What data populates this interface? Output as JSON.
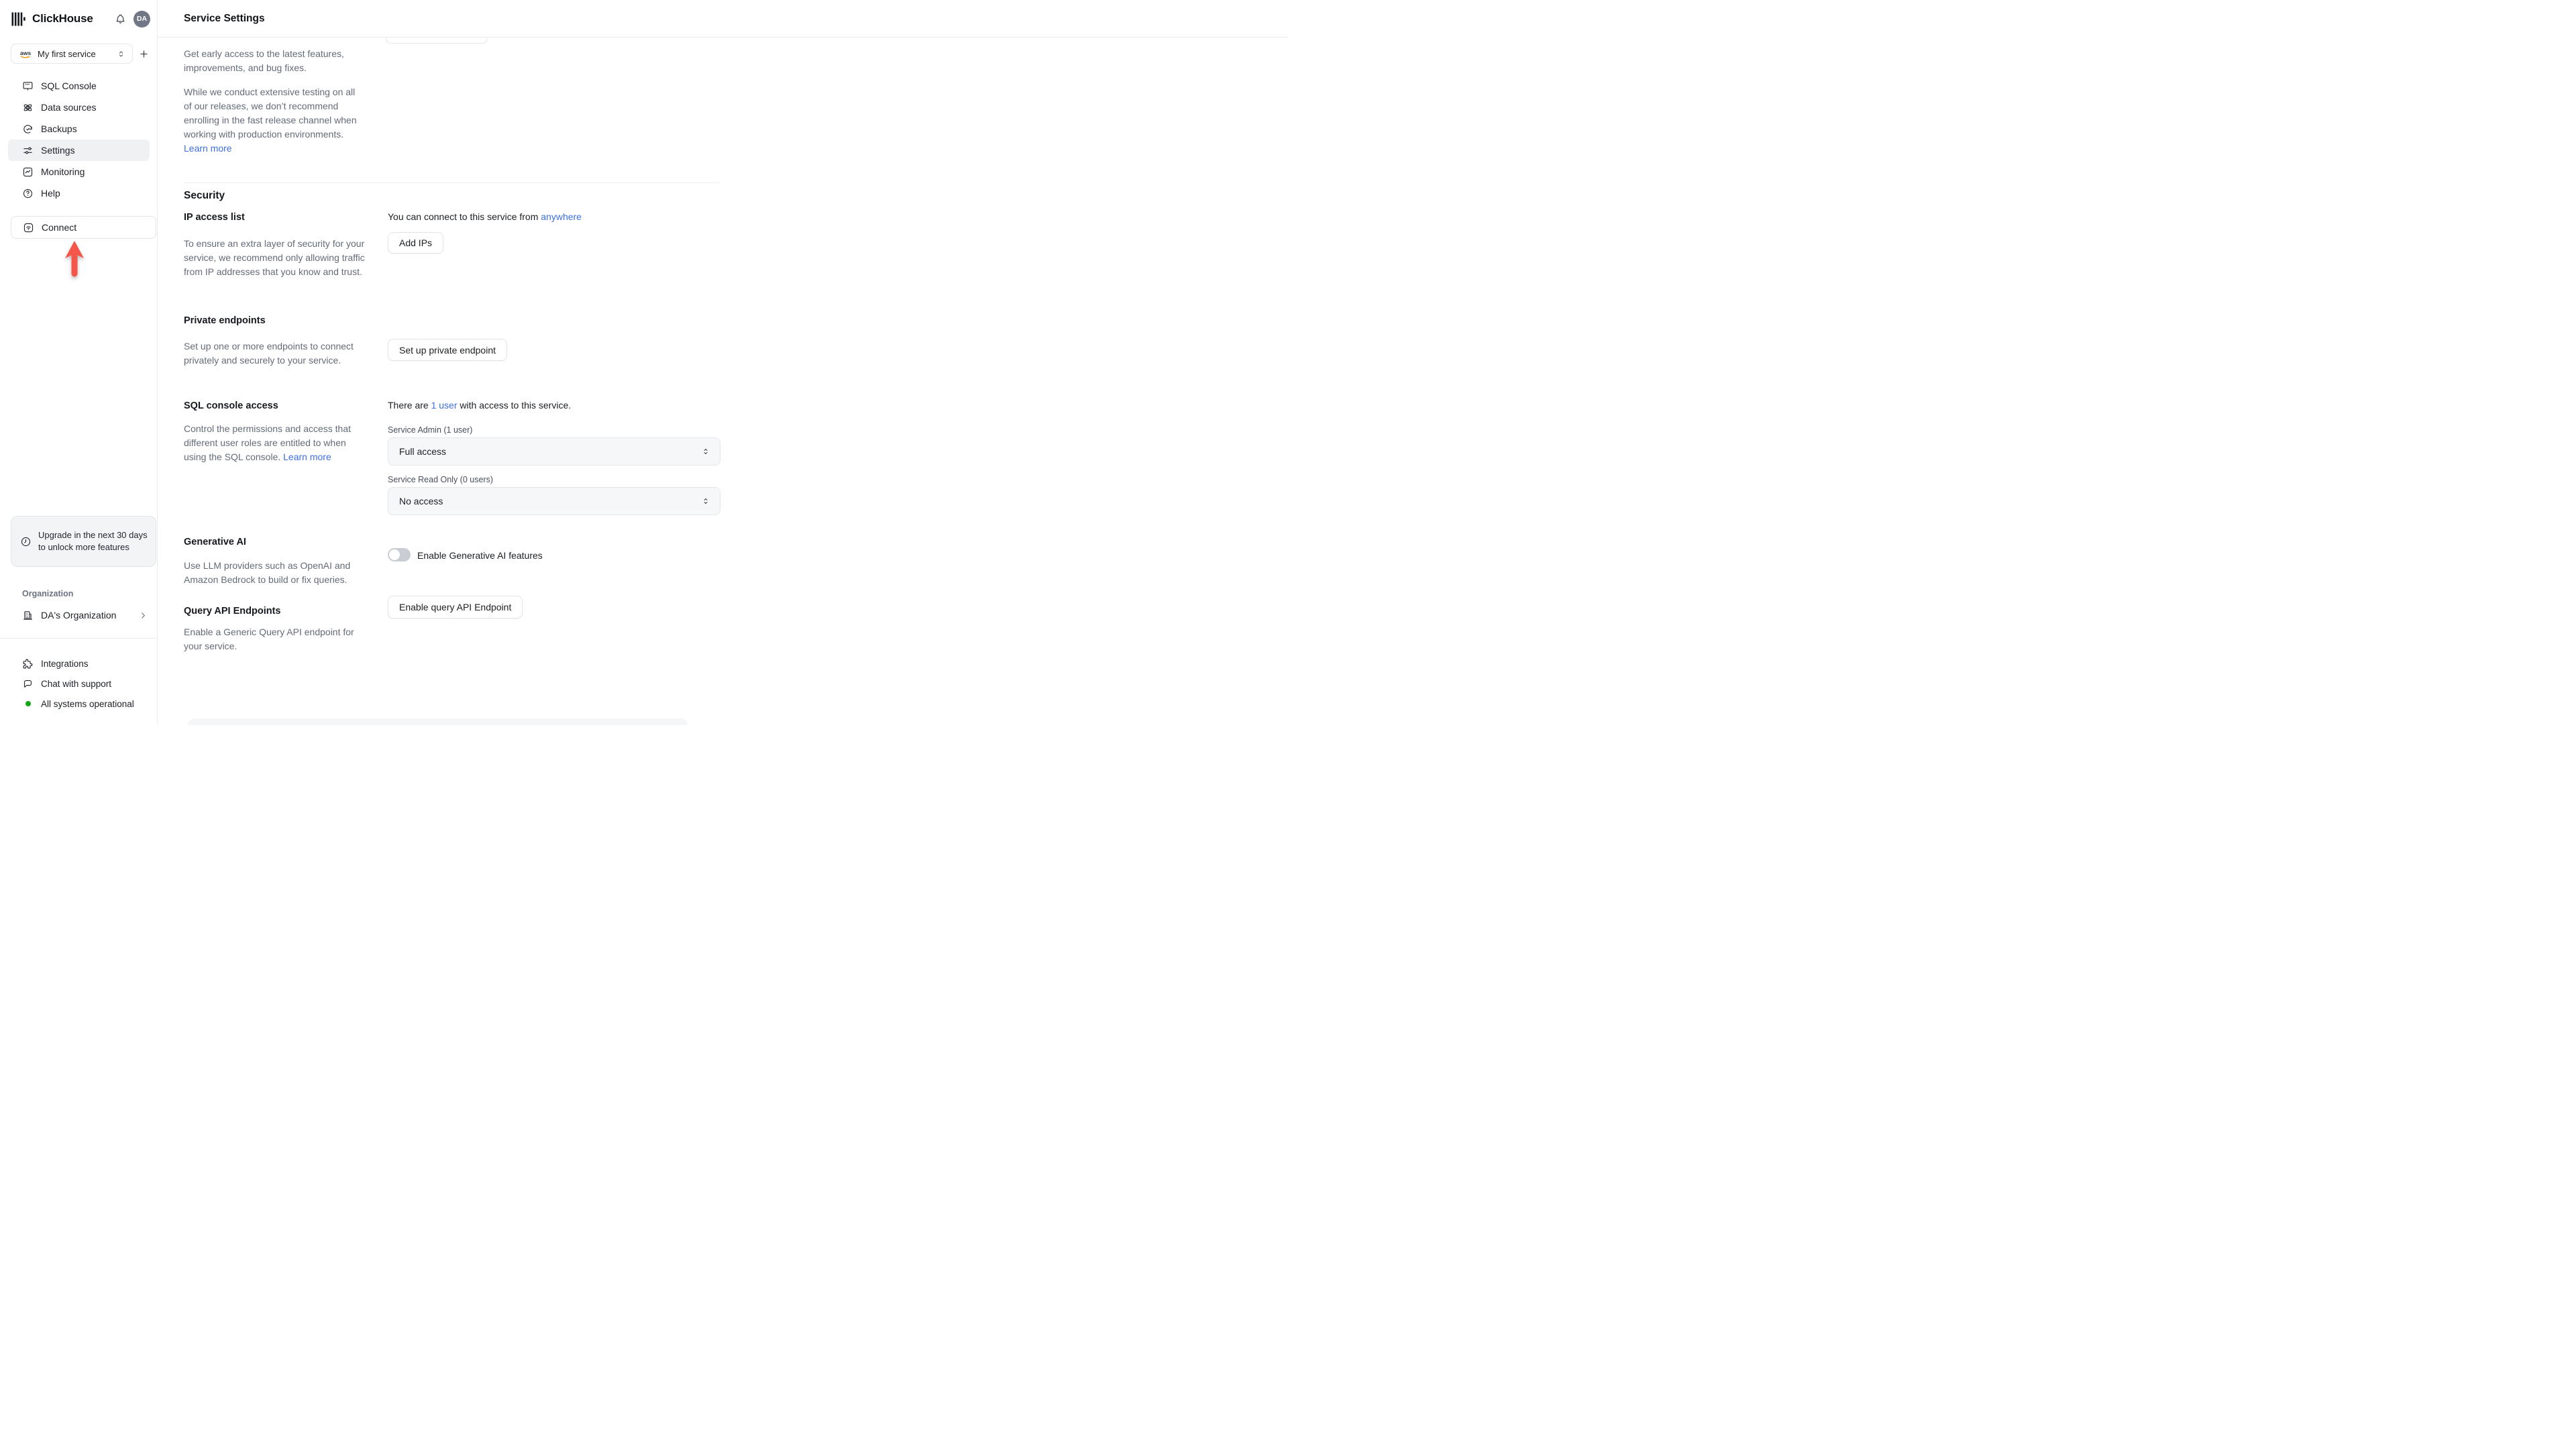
{
  "header": {
    "app_name": "ClickHouse",
    "avatar_initials": "DA"
  },
  "service_selector": {
    "name": "My first service",
    "provider": "aws"
  },
  "sidebar": {
    "nav": [
      {
        "label": "SQL Console"
      },
      {
        "label": "Data sources"
      },
      {
        "label": "Backups"
      },
      {
        "label": "Settings",
        "active": true
      },
      {
        "label": "Monitoring"
      },
      {
        "label": "Help"
      }
    ],
    "connect_label": "Connect",
    "upgrade_notice": "Upgrade in the next 30 days to unlock more features",
    "org_section_label": "Organization",
    "org_name": "DA's Organization",
    "footer": [
      {
        "label": "Integrations"
      },
      {
        "label": "Chat with support"
      },
      {
        "label": "All systems operational"
      }
    ]
  },
  "page": {
    "title": "Service Settings"
  },
  "release_channel": {
    "para1": "Get early access to the latest features, improvements, and bug fixes.",
    "para2": "While we conduct extensive testing on all of our releases, we don’t recommend enrolling in the fast release channel when working with production environments. ",
    "learn_more": "Learn more"
  },
  "security": {
    "heading": "Security",
    "ip_access": {
      "title": "IP access list",
      "description": "To ensure an extra layer of security for your service, we recommend only allowing traffic from IP addresses that you know and trust.",
      "status_prefix": "You can connect to this service from ",
      "status_link": "anywhere",
      "button": "Add IPs"
    },
    "private_endpoints": {
      "title": "Private endpoints",
      "description": "Set up one or more endpoints to connect privately and securely to your service.",
      "button": "Set up private endpoint"
    },
    "sql_console_access": {
      "title": "SQL console access",
      "description": "Control the permissions and access that different user roles are entitled to when using the SQL console. ",
      "learn_more": "Learn more",
      "summary_prefix": "There are ",
      "summary_link": "1 user",
      "summary_suffix": " with access to this service.",
      "admin_label": "Service Admin (1 user)",
      "admin_value": "Full access",
      "readonly_label": "Service Read Only (0 users)",
      "readonly_value": "No access"
    },
    "generative_ai": {
      "title": "Generative AI",
      "description": "Use LLM providers such as OpenAI and Amazon Bedrock to build or fix queries.",
      "toggle_label": "Enable Generative AI features",
      "toggle_state": "off"
    },
    "query_api": {
      "title": "Query API Endpoints",
      "description": "Enable a Generic Query API endpoint for your service.",
      "button": "Enable query API Endpoint"
    }
  },
  "icons": {
    "clickhouse-logo-icon": "vertical-bars",
    "bell-icon": "notification bell",
    "aws-logo-icon": "aws",
    "chevron-updown-icon": "sort chevrons",
    "plus-icon": "+",
    "sql-console-icon": "terminal monitor",
    "data-sources-icon": "orbit",
    "backups-icon": "history clock",
    "settings-icon": "sliders",
    "monitoring-icon": "chart square",
    "help-icon": "question circle",
    "connect-wifi-icon": "wifi square",
    "red-up-arrow": "tutorial pointer",
    "clock-icon": "clock",
    "building-icon": "organization building",
    "chevron-right-icon": ">",
    "puzzle-icon": "integrations puzzle",
    "chat-bubble-icon": "speech bubble",
    "status-dot": "green dot"
  },
  "colors": {
    "accent_blue": "#3d6fe3",
    "status_green": "#12a317",
    "arrow_red": "#f4564a",
    "active_item_bg": "#f0f1f3"
  }
}
